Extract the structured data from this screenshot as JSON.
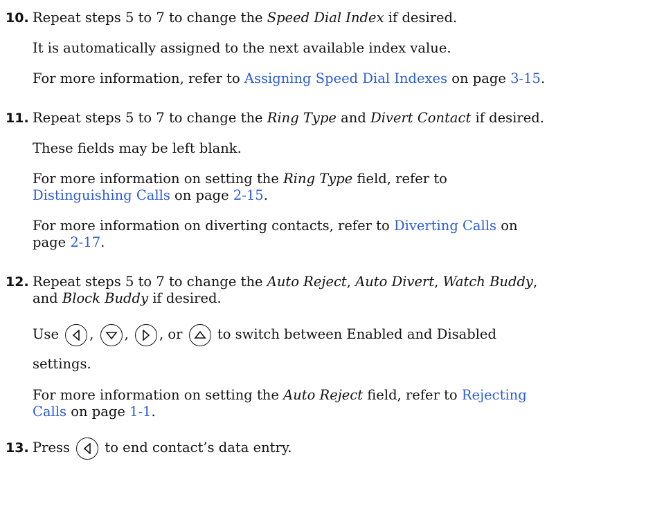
{
  "steps": [
    {
      "number": "10.",
      "lead_pre": "Repeat steps 5 to 7 to change the ",
      "lead_em1": "Speed Dial Index",
      "lead_post": " if desired.",
      "p1": "It is automatically assigned to the next available index value.",
      "ref_pre": "For more information, refer to ",
      "ref_link": "Assigning Speed Dial Indexes",
      "ref_mid": " on page ",
      "ref_page": "3-15",
      "ref_end": "."
    },
    {
      "number": "11.",
      "lead_pre": "Repeat steps 5 to 7 to change the ",
      "lead_em1": "Ring Type",
      "lead_and": " and ",
      "lead_em2": "Divert Contact",
      "lead_post": " if desired.",
      "p1": "These fields may be left blank.",
      "ref1_pre": "For more information on setting the ",
      "ref1_em": "Ring Type",
      "ref1_mid": " field, refer to",
      "ref1_link": "Distinguishing Calls",
      "ref1_on": " on page ",
      "ref1_page": "2-15",
      "ref1_end": ".",
      "ref2_pre": "For more information on diverting contacts, refer to ",
      "ref2_link": "Diverting Calls",
      "ref2_on": " on",
      "ref2_pg": "page ",
      "ref2_page": "2-17",
      "ref2_end": "."
    },
    {
      "number": "12.",
      "lead_pre": "Repeat steps 5 to 7 to change the ",
      "lead_em1": "Auto Reject",
      "sep1": ", ",
      "lead_em2": "Auto Divert",
      "sep2": ", ",
      "lead_em3": "Watch Buddy",
      "sep3": ",",
      "lead2_and": "and ",
      "lead2_em": "Block Buddy",
      "lead2_post": " if desired.",
      "use_word": "Use",
      "comma": ",",
      "or_word": ", or",
      "switch_text": "to switch between Enabled and Disabled",
      "settings": "settings.",
      "ref_pre": "For more information on setting the ",
      "ref_em": "Auto Reject",
      "ref_mid": " field, refer to ",
      "ref_link1": "Rejecting",
      "ref_link2": "Calls",
      "ref_on": " on page ",
      "ref_page": "1-1",
      "ref_end": "."
    },
    {
      "number": "13.",
      "press": "Press",
      "end_text": "to end contact’s data entry."
    }
  ],
  "icons": [
    "left-arrow-key-icon",
    "down-arrow-key-icon",
    "right-arrow-key-icon",
    "up-arrow-key-icon"
  ],
  "colors": {
    "link": "#2a5bd7",
    "text": "#111111"
  }
}
